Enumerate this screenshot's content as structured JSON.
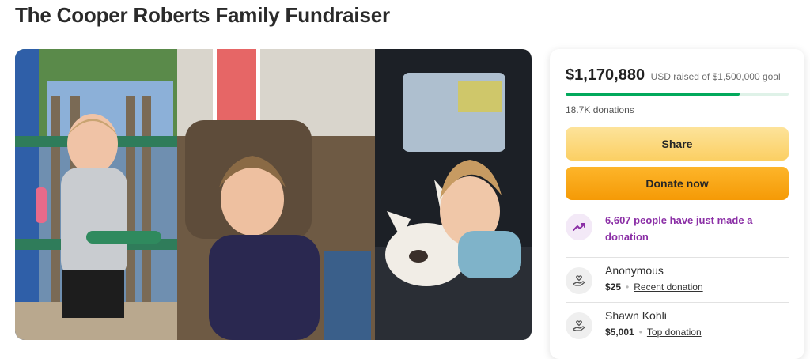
{
  "page": {
    "title": "The Cooper Roberts Family Fundraiser"
  },
  "photo": {
    "description_name": "campaign-photo"
  },
  "progress": {
    "raised": "$1,170,880",
    "raised_suffix": "USD raised of $1,500,000 goal",
    "fraction": 0.78,
    "donations": "18.7K donations"
  },
  "actions": {
    "share": "Share",
    "donate": "Donate now"
  },
  "activity": {
    "recent_text": "6,607 people have just made a donation"
  },
  "donors": [
    {
      "name": "Anonymous",
      "amount": "$25",
      "tag": "Recent donation"
    },
    {
      "name": "Shawn Kohli",
      "amount": "$5,001",
      "tag": "Top donation"
    }
  ],
  "colors": {
    "progress": "#02a95c",
    "share": "#fbcf63",
    "donate": "#f59a06",
    "accent": "#8b2fa6"
  }
}
